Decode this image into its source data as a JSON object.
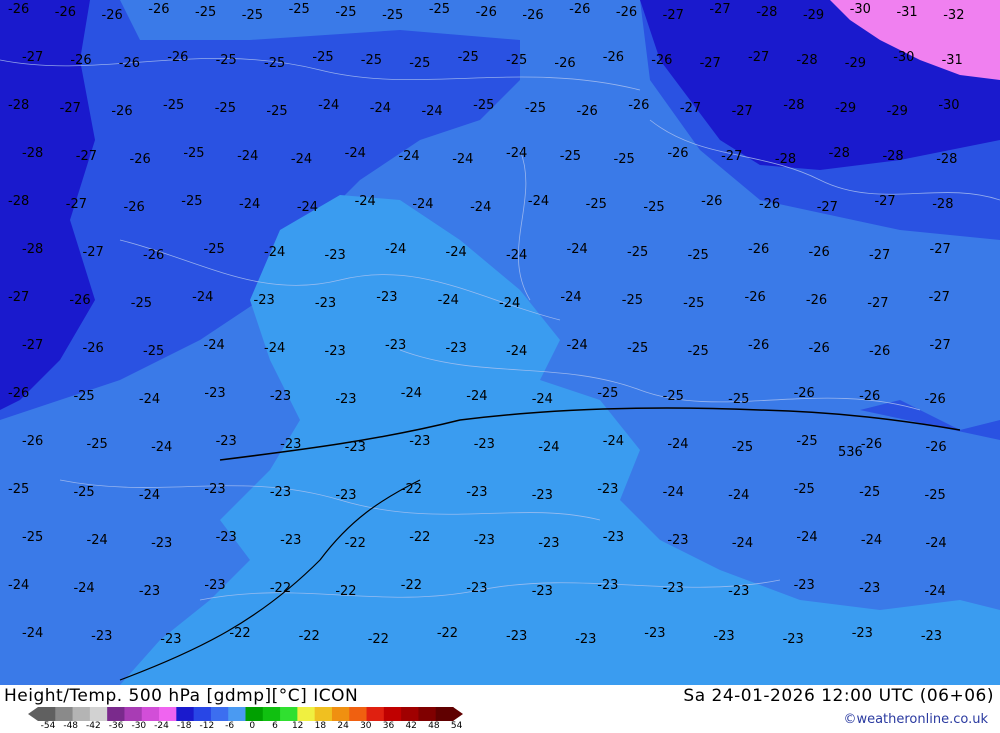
{
  "header": {
    "title_left": "Height/Temp. 500 hPa [gdmp][°C] ICON",
    "title_right": "Sa 24-01-2026 12:00 UTC (06+06)",
    "credit": "©weatheronline.co.uk"
  },
  "colorbar": {
    "labels": [
      "-54",
      "-48",
      "-42",
      "-36",
      "-30",
      "-24",
      "-18",
      "-12",
      "-6",
      "0",
      "6",
      "12",
      "18",
      "24",
      "30",
      "36",
      "42",
      "48",
      "54"
    ],
    "colors": [
      "#606060",
      "#8a8a8a",
      "#b4b4b4",
      "#d2d2d2",
      "#7a2a8c",
      "#a83cb4",
      "#d24ed8",
      "#f064f0",
      "#1a1acd",
      "#2846e6",
      "#3c6ef0",
      "#4a9af2",
      "#00a000",
      "#10c010",
      "#30e030",
      "#f0f040",
      "#f0c020",
      "#f09010",
      "#f06010",
      "#e02010",
      "#c00000",
      "#a00000",
      "#800000",
      "#600000"
    ],
    "layer_colors": {
      "t_minus_22": "#3a9cf0",
      "t_minus_24": "#3a7ae8",
      "t_minus_26": "#2a52e2",
      "t_minus_28": "#1a1acd",
      "t_minus_32": "#f080f0"
    }
  },
  "contour_labels": {
    "row1": [
      "-26",
      "-26",
      "-26",
      "-26",
      "-25",
      "-25",
      "-25",
      "-25",
      "-25",
      "-25",
      "-26",
      "-26",
      "-26",
      "-26",
      "-27",
      "-27",
      "-28",
      "-29",
      "-30",
      "-31",
      "-32"
    ],
    "row2": [
      "-27",
      "-26",
      "-26",
      "-26",
      "-25",
      "-25",
      "-25",
      "-25",
      "-25",
      "-25",
      "-25",
      "-26",
      "-26",
      "-26",
      "-27",
      "-27",
      "-28",
      "-29",
      "-30",
      "-31"
    ],
    "row3": [
      "-28",
      "-27",
      "-26",
      "-25",
      "-25",
      "-25",
      "-24",
      "-24",
      "-24",
      "-25",
      "-25",
      "-26",
      "-26",
      "-27",
      "-27",
      "-28",
      "-29",
      "-29",
      "-30"
    ],
    "row4": [
      "-28",
      "-27",
      "-26",
      "-25",
      "-24",
      "-24",
      "-24",
      "-24",
      "-24",
      "-24",
      "-25",
      "-25",
      "-26",
      "-27",
      "-28",
      "-28",
      "-28",
      "-28"
    ],
    "row5": [
      "-28",
      "-27",
      "-26",
      "-25",
      "-24",
      "-24",
      "-24",
      "-24",
      "-24",
      "-24",
      "-25",
      "-25",
      "-26",
      "-26",
      "-27",
      "-27",
      "-28"
    ],
    "row6": [
      "-28",
      "-27",
      "-26",
      "-25",
      "-24",
      "-23",
      "-24",
      "-24",
      "-24",
      "-24",
      "-25",
      "-25",
      "-26",
      "-26",
      "-27",
      "-27"
    ],
    "row7": [
      "-27",
      "-26",
      "-25",
      "-24",
      "-23",
      "-23",
      "-23",
      "-24",
      "-24",
      "-24",
      "-25",
      "-25",
      "-26",
      "-26",
      "-27",
      "-27"
    ],
    "row8": [
      "-27",
      "-26",
      "-25",
      "-24",
      "-24",
      "-23",
      "-23",
      "-23",
      "-24",
      "-24",
      "-25",
      "-25",
      "-26",
      "-26",
      "-26",
      "-27"
    ],
    "row9": [
      "-26",
      "-25",
      "-24",
      "-23",
      "-23",
      "-23",
      "-24",
      "-24",
      "-24",
      "-25",
      "-25",
      "-25",
      "-26",
      "-26",
      "-26"
    ],
    "row10": [
      "-26",
      "-25",
      "-24",
      "-23",
      "-23",
      "-23",
      "-23",
      "-23",
      "-24",
      "-24",
      "-24",
      "-25",
      "-25",
      "-26",
      "-26"
    ],
    "row11": [
      "-25",
      "-25",
      "-24",
      "-23",
      "-23",
      "-23",
      "-22",
      "-23",
      "-23",
      "-23",
      "-24",
      "-24",
      "-25",
      "-25",
      "-25"
    ],
    "row12": [
      "-25",
      "-24",
      "-23",
      "-23",
      "-23",
      "-22",
      "-22",
      "-23",
      "-23",
      "-23",
      "-23",
      "-24",
      "-24",
      "-24",
      "-24"
    ],
    "row13": [
      "-24",
      "-24",
      "-23",
      "-23",
      "-22",
      "-22",
      "-22",
      "-23",
      "-23",
      "-23",
      "-23",
      "-23",
      "-23",
      "-23",
      "-24"
    ],
    "row14": [
      "-24",
      "-23",
      "-23",
      "-22",
      "-22",
      "-22",
      "-22",
      "-23",
      "-23",
      "-23",
      "-23",
      "-23",
      "-23",
      "-23"
    ],
    "special": "536"
  }
}
